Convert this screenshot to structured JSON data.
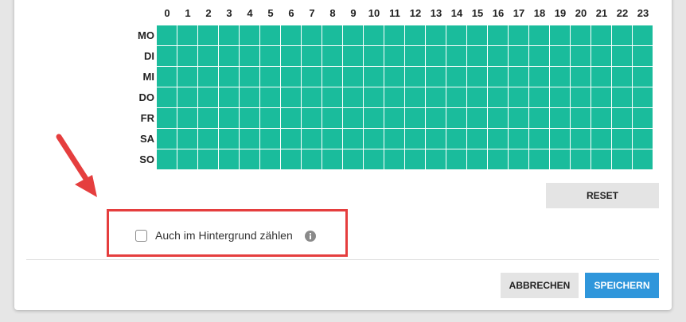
{
  "schedule": {
    "hours": [
      "0",
      "1",
      "2",
      "3",
      "4",
      "5",
      "6",
      "7",
      "8",
      "9",
      "10",
      "11",
      "12",
      "13",
      "14",
      "15",
      "16",
      "17",
      "18",
      "19",
      "20",
      "21",
      "22",
      "23"
    ],
    "days": [
      "MO",
      "DI",
      "MI",
      "DO",
      "FR",
      "SA",
      "SO"
    ],
    "active_color": "#1abc9c",
    "all_active": true
  },
  "reset_label": "RESET",
  "background_count": {
    "label": "Auch im Hintergrund zählen",
    "checked": false,
    "info_icon": "info-circle-icon"
  },
  "footer": {
    "cancel_label": "ABBRECHEN",
    "save_label": "SPEICHERN",
    "save_color": "#2f96db"
  },
  "annotation": {
    "arrow_color": "#e53e3e",
    "highlight_color": "#e53e3e"
  }
}
